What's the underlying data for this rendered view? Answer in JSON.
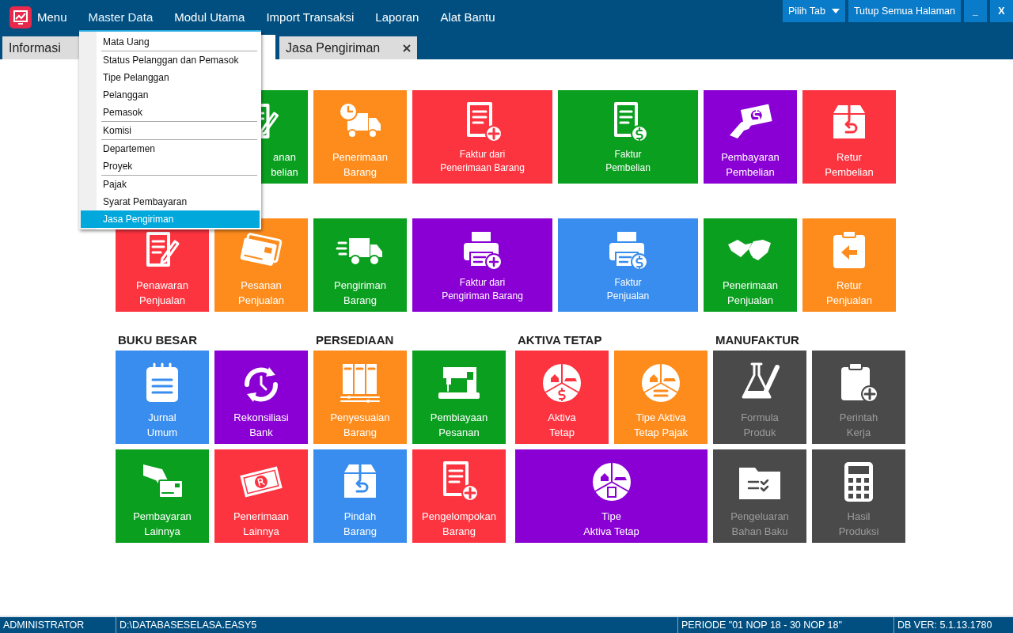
{
  "menu_bar": {
    "logo_label": "Menu",
    "items": [
      {
        "label": "Master Data",
        "expanded": true
      },
      {
        "label": "Modul Utama",
        "expanded": false
      },
      {
        "label": "Import Transaksi",
        "expanded": false
      },
      {
        "label": "Laporan",
        "expanded": false
      },
      {
        "label": "Alat Bantu",
        "expanded": false
      }
    ]
  },
  "window_buttons": [
    {
      "label": "Pilih Tab",
      "kind": "dropdown"
    },
    {
      "label": "Tutup Semua Halaman",
      "kind": "plain"
    },
    {
      "label": "_",
      "kind": "plain"
    },
    {
      "label": "X",
      "kind": "plain"
    }
  ],
  "tabs": [
    {
      "label": "Informasi",
      "closable": false
    },
    {
      "label": "Jasa Pengiriman",
      "closable": true
    }
  ],
  "dropdown": {
    "groups": [
      [
        {
          "label": "Mata Uang",
          "selected": false
        }
      ],
      [
        {
          "label": "Status Pelanggan dan Pemasok",
          "selected": false
        },
        {
          "label": "Tipe Pelanggan",
          "selected": false
        },
        {
          "label": "Pelanggan",
          "selected": false
        },
        {
          "label": "Pemasok",
          "selected": false
        }
      ],
      [
        {
          "label": "Komisi",
          "selected": false
        }
      ],
      [
        {
          "label": "Departemen",
          "selected": false
        },
        {
          "label": "Proyek",
          "selected": false
        }
      ],
      [
        {
          "label": "Pajak",
          "selected": false
        },
        {
          "label": "Syarat Pembayaran",
          "selected": false
        },
        {
          "label": "Jasa Pengiriman",
          "selected": true
        }
      ]
    ]
  },
  "tile_rows": [
    {
      "tiles": [
        {
          "label": "anan\nbelian",
          "color": "#0a9f1f",
          "kind": "cut",
          "wide": false
        },
        {
          "label": "Penerimaan\nBarang",
          "color": "#fd8c1d",
          "kind": "tile",
          "wide": false
        },
        {
          "label": "Faktur dari\nPenerimaan Barang",
          "color": "#fc3440",
          "kind": "tile",
          "wide": true
        },
        {
          "label": "Faktur\nPembelian",
          "color": "#0a9f1f",
          "kind": "tile",
          "wide": true
        },
        {
          "label": "Pembayaran\nPembelian",
          "color": "#8a00d4",
          "kind": "tile",
          "wide": false
        },
        {
          "label": "Retur\nPembelian",
          "color": "#fc3440",
          "kind": "tile",
          "wide": false
        }
      ]
    },
    {
      "tiles": [
        {
          "label": "Penawaran\nPenjualan",
          "color": "#fc3440",
          "kind": "tile",
          "wide": false
        },
        {
          "label": "Pesanan\nPenjualan",
          "color": "#fd8c1d",
          "kind": "tile",
          "wide": false
        },
        {
          "label": "Pengiriman\nBarang",
          "color": "#0a9f1f",
          "kind": "tile",
          "wide": false
        },
        {
          "label": "Faktur dari\nPengiriman Barang",
          "color": "#8a00d4",
          "kind": "tile",
          "wide": true
        },
        {
          "label": "Faktur\nPenjualan",
          "color": "#388dee",
          "kind": "tile",
          "wide": true
        },
        {
          "label": "Penerimaan\nPenjualan",
          "color": "#0a9f1f",
          "kind": "tile",
          "wide": false
        },
        {
          "label": "Retur\nPenjualan",
          "color": "#fd8c1d",
          "kind": "tile",
          "wide": false
        }
      ]
    }
  ],
  "sections": [
    {
      "heading": "BUKU BESAR",
      "tiles": [
        {
          "label": "Jurnal\nUmum",
          "color": "#388dee",
          "wide": false,
          "disabled": false
        },
        {
          "label": "Rekonsiliasi\nBank",
          "color": "#8a00d4",
          "wide": false,
          "disabled": false
        },
        {
          "label": "Pembayaran\nLainnya",
          "color": "#0a9f1f",
          "wide": false,
          "disabled": false
        },
        {
          "label": "Penerimaan\nLainnya",
          "color": "#fc3440",
          "wide": false,
          "disabled": false
        }
      ]
    },
    {
      "heading": "PERSEDIAAN",
      "tiles": [
        {
          "label": "Penyesuaian\nBarang",
          "color": "#fd8c1d",
          "wide": false,
          "disabled": false
        },
        {
          "label": "Pembiayaan\nPesanan",
          "color": "#0a9f1f",
          "wide": false,
          "disabled": false
        },
        {
          "label": "Pindah\nBarang",
          "color": "#388dee",
          "wide": false,
          "disabled": false
        },
        {
          "label": "Pengelompokan\nBarang",
          "color": "#fc3440",
          "wide": false,
          "disabled": false
        }
      ]
    },
    {
      "heading": "AKTIVA TETAP",
      "tiles": [
        {
          "label": "Aktiva\nTetap",
          "color": "#fc3440",
          "wide": false,
          "disabled": false
        },
        {
          "label": "Tipe Aktiva\nTetap Pajak",
          "color": "#fd8c1d",
          "wide": false,
          "disabled": false
        },
        {
          "label": "Tipe\nAktiva Tetap",
          "color": "#8a00d4",
          "wide": true,
          "disabled": false
        }
      ]
    },
    {
      "heading": "MANUFAKTUR",
      "tiles": [
        {
          "label": "Formula\nProduk",
          "color": "#4a4a4a",
          "wide": false,
          "disabled": true
        },
        {
          "label": "Perintah\nKerja",
          "color": "#4a4a4a",
          "wide": false,
          "disabled": true
        },
        {
          "label": "Pengeluaran\nBahan Baku",
          "color": "#4a4a4a",
          "wide": false,
          "disabled": true
        },
        {
          "label": "Hasil\nProduksi",
          "color": "#4a4a4a",
          "wide": false,
          "disabled": true
        }
      ]
    }
  ],
  "status_bar": [
    "ADMINISTRATOR",
    "D:\\DATABASESELASA.EASY5",
    "PERIODE \"01 NOP 18 - 30 NOP 18\"",
    "DB VER: 5.1.13.1780"
  ]
}
